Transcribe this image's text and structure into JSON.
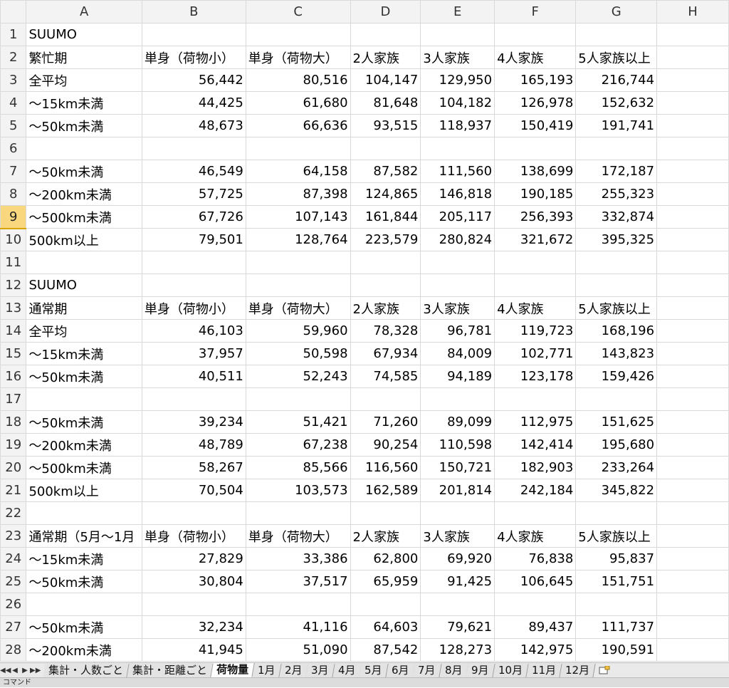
{
  "columns": [
    "A",
    "B",
    "C",
    "D",
    "E",
    "F",
    "G",
    "H"
  ],
  "selected_row": 9,
  "rows": [
    {
      "num": "1",
      "cells": [
        "SUUMO",
        "",
        "",
        "",
        "",
        "",
        ""
      ]
    },
    {
      "num": "2",
      "cells": [
        "繁忙期",
        "単身（荷物小）",
        "単身（荷物大）",
        "2人家族",
        "3人家族",
        "4人家族",
        "5人家族以上"
      ]
    },
    {
      "num": "3",
      "cells": [
        "全平均",
        "56,442",
        "80,516",
        "104,147",
        "129,950",
        "165,193",
        "216,744"
      ]
    },
    {
      "num": "4",
      "cells": [
        "～15km未満",
        "44,425",
        "61,680",
        "81,648",
        "104,182",
        "126,978",
        "152,632"
      ]
    },
    {
      "num": "5",
      "cells": [
        "～50km未満",
        "48,673",
        "66,636",
        "93,515",
        "118,937",
        "150,419",
        "191,741"
      ]
    },
    {
      "num": "6",
      "cells": [
        "",
        "",
        "",
        "",
        "",
        "",
        ""
      ]
    },
    {
      "num": "7",
      "cells": [
        "～50km未満",
        "46,549",
        "64,158",
        "87,582",
        "111,560",
        "138,699",
        "172,187"
      ]
    },
    {
      "num": "8",
      "cells": [
        "～200km未満",
        "57,725",
        "87,398",
        "124,865",
        "146,818",
        "190,185",
        "255,323"
      ]
    },
    {
      "num": "9",
      "cells": [
        "～500km未満",
        "67,726",
        "107,143",
        "161,844",
        "205,117",
        "256,393",
        "332,874"
      ]
    },
    {
      "num": "10",
      "cells": [
        "500km以上",
        "79,501",
        "128,764",
        "223,579",
        "280,824",
        "321,672",
        "395,325"
      ]
    },
    {
      "num": "11",
      "cells": [
        "",
        "",
        "",
        "",
        "",
        "",
        ""
      ]
    },
    {
      "num": "12",
      "cells": [
        "SUUMO",
        "",
        "",
        "",
        "",
        "",
        ""
      ]
    },
    {
      "num": "13",
      "cells": [
        "通常期",
        "単身（荷物小）",
        "単身（荷物大）",
        "2人家族",
        "3人家族",
        "4人家族",
        "5人家族以上"
      ]
    },
    {
      "num": "14",
      "cells": [
        "全平均",
        "46,103",
        "59,960",
        "78,328",
        "96,781",
        "119,723",
        "168,196"
      ]
    },
    {
      "num": "15",
      "cells": [
        "～15km未満",
        "37,957",
        "50,598",
        "67,934",
        "84,009",
        "102,771",
        "143,823"
      ]
    },
    {
      "num": "16",
      "cells": [
        "～50km未満",
        "40,511",
        "52,243",
        "74,585",
        "94,189",
        "123,178",
        "159,426"
      ]
    },
    {
      "num": "17",
      "cells": [
        "",
        "",
        "",
        "",
        "",
        "",
        ""
      ]
    },
    {
      "num": "18",
      "cells": [
        "～50km未満",
        "39,234",
        "51,421",
        "71,260",
        "89,099",
        "112,975",
        "151,625"
      ]
    },
    {
      "num": "19",
      "cells": [
        "～200km未満",
        "48,789",
        "67,238",
        "90,254",
        "110,598",
        "142,414",
        "195,680"
      ]
    },
    {
      "num": "20",
      "cells": [
        "～500km未満",
        "58,267",
        "85,566",
        "116,560",
        "150,721",
        "182,903",
        "233,264"
      ]
    },
    {
      "num": "21",
      "cells": [
        "500km以上",
        "70,504",
        "103,573",
        "162,589",
        "201,814",
        "242,184",
        "345,822"
      ]
    },
    {
      "num": "22",
      "cells": [
        "",
        "",
        "",
        "",
        "",
        "",
        ""
      ]
    },
    {
      "num": "23",
      "cells": [
        "通常期（5月～1月",
        "単身（荷物小）",
        "単身（荷物大）",
        "2人家族",
        "3人家族",
        "4人家族",
        "5人家族以上"
      ]
    },
    {
      "num": "24",
      "cells": [
        "～15km未満",
        "27,829",
        "33,386",
        "62,800",
        "69,920",
        "76,838",
        "95,837"
      ]
    },
    {
      "num": "25",
      "cells": [
        "～50km未満",
        "30,804",
        "37,517",
        "65,959",
        "91,425",
        "106,645",
        "151,751"
      ]
    },
    {
      "num": "26",
      "cells": [
        "",
        "",
        "",
        "",
        "",
        "",
        ""
      ]
    },
    {
      "num": "27",
      "cells": [
        "～50km未満",
        "32,234",
        "41,116",
        "64,603",
        "79,621",
        "89,437",
        "111,737"
      ]
    },
    {
      "num": "28",
      "cells": [
        "～200km未満",
        "41,945",
        "51,090",
        "87,542",
        "128,273",
        "142,975",
        "190,591"
      ]
    }
  ],
  "sheet_tabs": [
    "集計・人数ごと",
    "集計・距離ごと",
    "荷物量",
    "1月",
    "2月",
    "3月",
    "4月",
    "5月",
    "6月",
    "7月",
    "8月",
    "9月",
    "10月",
    "11月",
    "12月"
  ],
  "active_tab": "荷物量",
  "status_text": "コマンド"
}
